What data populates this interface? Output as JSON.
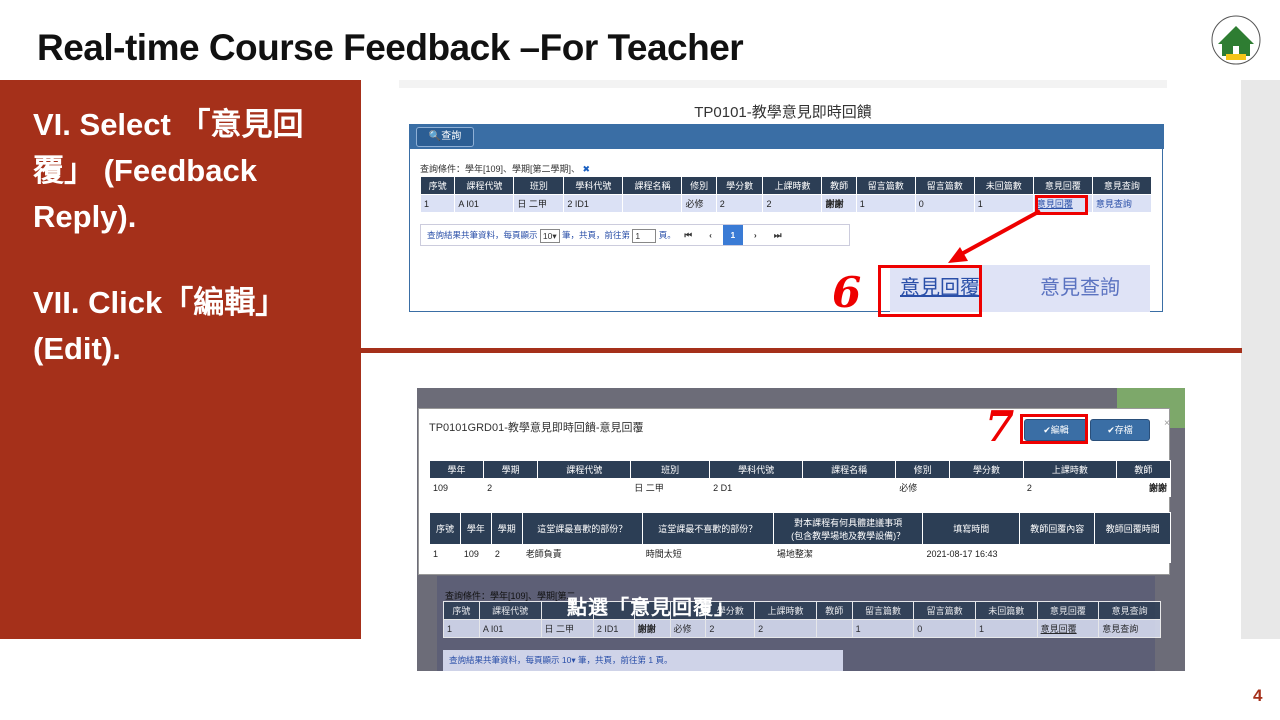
{
  "slide": {
    "title": "Real-time Course Feedback –For Teacher",
    "page_number": "4",
    "instructions": [
      "VI. Select 「意見回",
      "覆」 (Feedback",
      "Reply).",
      "VII. Click「編輯」",
      "(Edit)."
    ]
  },
  "screenshot1": {
    "system_title": "TP0101-教學意見即時回饋",
    "query_button": "🔍查詢",
    "condition": "查詢條件：學年[109]、學期[第二學期]、",
    "condition_clear": "✖",
    "headers": [
      "序號",
      "課程代號",
      "班別",
      "學科代號",
      "課程名稱",
      "修別",
      "學分數",
      "上課時數",
      "教師",
      "留言篇數",
      "留言篇數",
      "未回篇數",
      "意見回覆",
      "意見查詢"
    ],
    "row": {
      "seq": "1",
      "course_code": "A     I01",
      "class": "日  二甲",
      "dept_code": "2   ID1",
      "course_name": "",
      "type": "必修",
      "credits": "2",
      "hours": "2",
      "teacher": "謝謝",
      "comments": "1",
      "comments2": "0",
      "unreplied": "1",
      "reply_link": "意見回覆",
      "query_link": "意見查詢"
    },
    "pager": {
      "prefix": "查詢結果共筆資料，每頁顯示",
      "page_size": "10▾",
      "middle": "筆，共頁，前往第",
      "goto": "1",
      "suffix": "頁。",
      "current": "1"
    },
    "zoom": {
      "reply": "意見回覆",
      "query": "意見查詢"
    },
    "step_number": "6"
  },
  "screenshot2": {
    "modal_title": "TP0101GRD01-教學意見即時回饋-意見回覆",
    "edit_button": "✔編輯",
    "save_button": "✔存檔",
    "close": "×",
    "info_headers": [
      "學年",
      "學期",
      "課程代號",
      "班別",
      "學科代號",
      "課程名稱",
      "修別",
      "學分數",
      "上課時數",
      "教師"
    ],
    "info_row": [
      "109",
      "2",
      "",
      "日  二甲",
      "2    D1",
      "",
      "必修",
      "",
      "2",
      "謝謝"
    ],
    "feedback_headers": [
      "序號",
      "學年",
      "學期",
      "這堂課最喜歡的部份？",
      "這堂課最不喜歡的部份？",
      "對本課程有何具體建議事項",
      "(包含教學場地及教學設備)？",
      "填寫時間",
      "教師回覆內容",
      "教師回覆時間"
    ],
    "feedback_row": [
      "1",
      "109",
      "2",
      "老師負責",
      "時間太短",
      "場地整潔",
      "2021-08-17 16:43",
      "",
      ""
    ],
    "bg_condition": "查詢條件：學年[109]、學期[第二",
    "overlay_caption": "點選「意見回覆」",
    "bg_headers": [
      "序號",
      "課程代號",
      "",
      "",
      "",
      "",
      "學分數",
      "上課時數",
      "教師",
      "留言篇數",
      "留言篇數",
      "未回篇數",
      "意見回覆",
      "意見查詢"
    ],
    "bg_row": [
      "1",
      "A      I01",
      "日  二甲",
      "2   ID1",
      "謝謝",
      "必修",
      "2",
      "2",
      "",
      "1",
      "0",
      "1",
      "意見回覆",
      "意見查詢"
    ],
    "bg_pager_prefix": "查詢結果共筆資料，每頁顯示",
    "bg_pager_middle": "筆，共頁，前往第",
    "bg_pager_suffix": "頁。",
    "step_number": "7"
  },
  "colors": {
    "accent": "#a5301a",
    "header_dark": "#2c3e55",
    "row_light": "#dbe1f5",
    "link_blue": "#2a4fa8",
    "highlight_red": "#e00000"
  }
}
